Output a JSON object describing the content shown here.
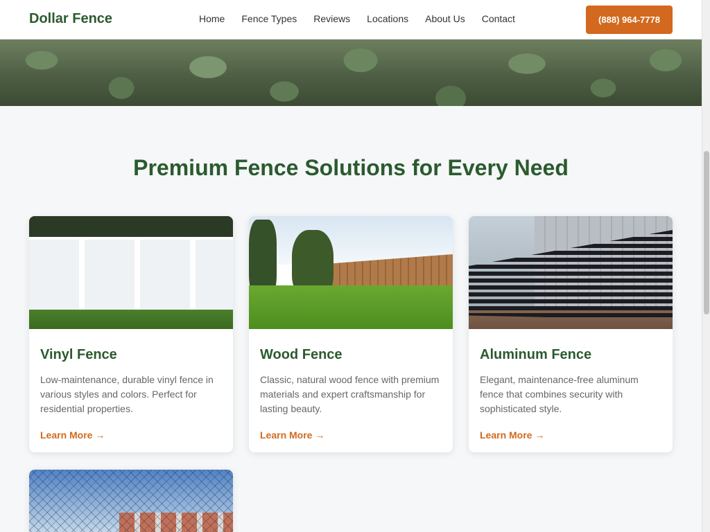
{
  "header": {
    "logo": "Dollar Fence",
    "nav": [
      "Home",
      "Fence Types",
      "Reviews",
      "Locations",
      "About Us",
      "Contact"
    ],
    "phone": "(888) 964-7778"
  },
  "section": {
    "title": "Premium Fence Solutions for Every Need"
  },
  "cards": [
    {
      "title": "Vinyl Fence",
      "description": "Low-maintenance, durable vinyl fence in various styles and colors. Perfect for residential properties.",
      "link": "Learn More →"
    },
    {
      "title": "Wood Fence",
      "description": "Classic, natural wood fence with premium materials and expert craftsmanship for lasting beauty.",
      "link": "Learn More →"
    },
    {
      "title": "Aluminum Fence",
      "description": "Elegant, maintenance-free aluminum fence that combines security with sophisticated style.",
      "link": "Learn More →"
    }
  ],
  "colors": {
    "brand_green": "#2b5a2e",
    "accent_orange": "#d2691e"
  }
}
